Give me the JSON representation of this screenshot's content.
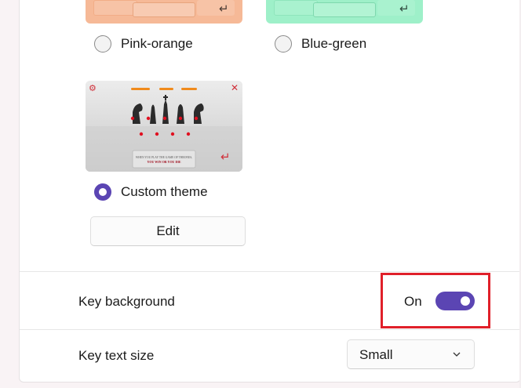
{
  "themes": [
    {
      "label": "Pink-orange",
      "selected": false,
      "color": "#f6b997"
    },
    {
      "label": "Blue-green",
      "selected": false,
      "color": "#9ef0c9"
    },
    {
      "label": "Custom theme",
      "selected": true
    }
  ],
  "custom_thumb": {
    "caption_line1": "WHEN YOU PLAY THE GAME OF THRONES,",
    "caption_line2": "YOU WIN OR YOU DIE"
  },
  "edit_button": {
    "label": "Edit"
  },
  "key_background": {
    "label": "Key background",
    "state": "On",
    "on": true
  },
  "key_text_size": {
    "label": "Key text size",
    "value": "Small"
  },
  "colors": {
    "accent": "#5b45b3",
    "highlight": "#e0202a"
  },
  "icons": {
    "enter": "enter-icon",
    "close": "close-icon",
    "settings": "gear-icon",
    "chevron": "chevron-down-icon"
  }
}
